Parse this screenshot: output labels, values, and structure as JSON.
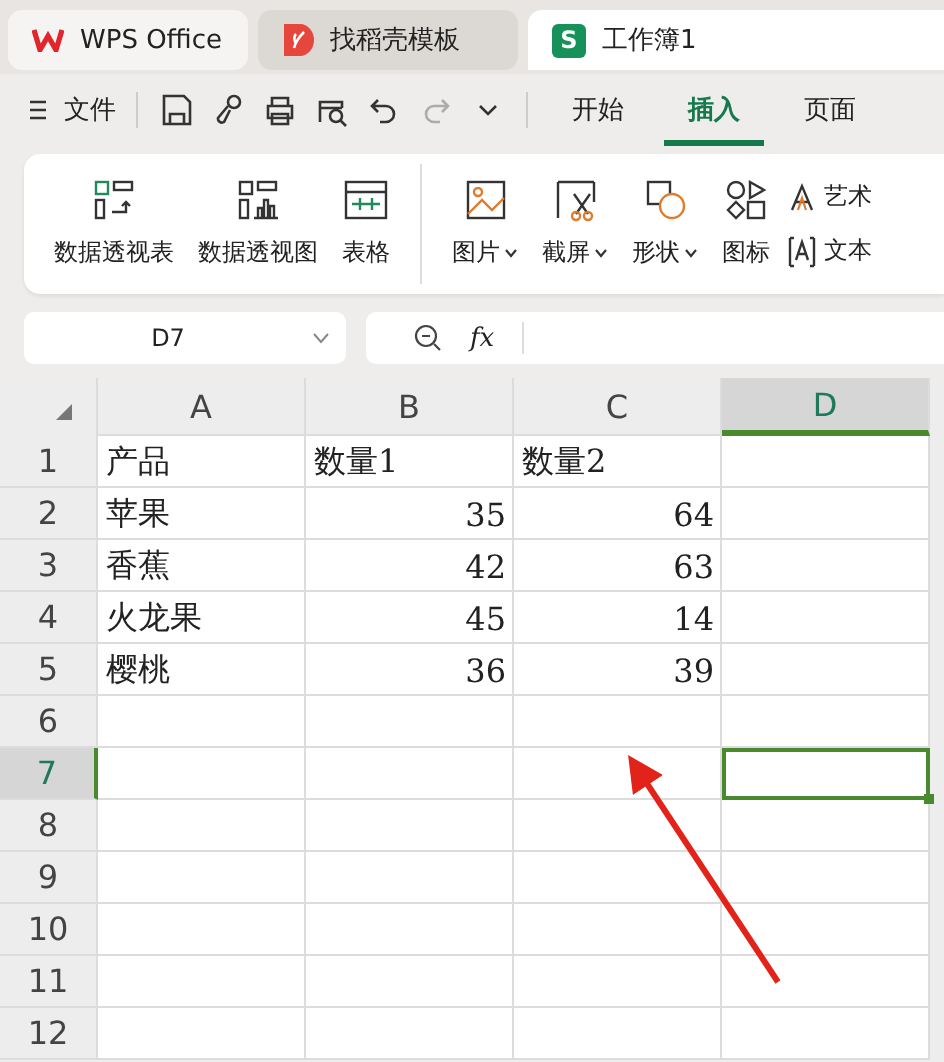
{
  "tabs": [
    {
      "label": "WPS Office",
      "kind": "home",
      "selected": false
    },
    {
      "label": "找稻壳模板",
      "kind": "docer",
      "selected": false
    },
    {
      "label": "工作簿1",
      "kind": "sheet",
      "icon_text": "S",
      "selected": true
    }
  ],
  "menu": {
    "file_label": "文件",
    "quick_tools": [
      {
        "kind": "save",
        "disabled": false
      },
      {
        "kind": "painter",
        "disabled": false
      },
      {
        "kind": "print",
        "disabled": false
      },
      {
        "kind": "preview",
        "disabled": false
      },
      {
        "kind": "undo",
        "disabled": false
      },
      {
        "kind": "redo",
        "disabled": true
      },
      {
        "kind": "more",
        "disabled": false
      }
    ],
    "tabs": [
      {
        "label": "开始",
        "selected": false
      },
      {
        "label": "插入",
        "selected": true
      },
      {
        "label": "页面",
        "selected": false
      }
    ]
  },
  "ribbon": {
    "items": [
      {
        "label": "数据透视表",
        "kind": "pivot-table",
        "dropdown": false
      },
      {
        "label": "数据透视图",
        "kind": "pivot-chart",
        "dropdown": false
      },
      {
        "label": "表格",
        "kind": "table",
        "dropdown": false
      },
      {
        "label": "图片",
        "kind": "picture",
        "dropdown": true
      },
      {
        "label": "截屏",
        "kind": "screenshot",
        "dropdown": true
      },
      {
        "label": "形状",
        "kind": "shapes",
        "dropdown": true
      },
      {
        "label": "图标",
        "kind": "icons",
        "dropdown": false
      }
    ],
    "small_items": [
      {
        "label": "艺术",
        "kind": "wordart"
      },
      {
        "label": "文本",
        "kind": "textbox"
      }
    ]
  },
  "formula_bar": {
    "name_box": "D7",
    "function_label": "fx"
  },
  "sheet": {
    "columns": [
      {
        "label": "A",
        "selected": false
      },
      {
        "label": "B",
        "selected": false
      },
      {
        "label": "C",
        "selected": false
      },
      {
        "label": "D",
        "selected": true
      }
    ],
    "rows": [
      {
        "label": "1",
        "selected": false,
        "cells": [
          {
            "text": "产品",
            "kind": "text"
          },
          {
            "text": "数量1",
            "kind": "text"
          },
          {
            "text": "数量2",
            "kind": "text"
          }
        ]
      },
      {
        "label": "2",
        "selected": false,
        "cells": [
          {
            "text": "苹果",
            "kind": "text"
          },
          {
            "text": "35",
            "kind": "number"
          },
          {
            "text": "64",
            "kind": "number"
          }
        ]
      },
      {
        "label": "3",
        "selected": false,
        "cells": [
          {
            "text": "香蕉",
            "kind": "text"
          },
          {
            "text": "42",
            "kind": "number"
          },
          {
            "text": "63",
            "kind": "number"
          }
        ]
      },
      {
        "label": "4",
        "selected": false,
        "cells": [
          {
            "text": "火龙果",
            "kind": "text"
          },
          {
            "text": "45",
            "kind": "number"
          },
          {
            "text": "14",
            "kind": "number"
          }
        ]
      },
      {
        "label": "5",
        "selected": false,
        "cells": [
          {
            "text": "樱桃",
            "kind": "text"
          },
          {
            "text": "36",
            "kind": "number"
          },
          {
            "text": "39",
            "kind": "number"
          }
        ]
      },
      {
        "label": "6",
        "selected": false
      },
      {
        "label": "7",
        "selected": true
      },
      {
        "label": "8",
        "selected": false
      },
      {
        "label": "9",
        "selected": false
      },
      {
        "label": "10",
        "selected": false
      },
      {
        "label": "11",
        "selected": false
      },
      {
        "label": "12",
        "selected": false
      }
    ]
  },
  "annotation": {
    "kind": "arrow"
  }
}
